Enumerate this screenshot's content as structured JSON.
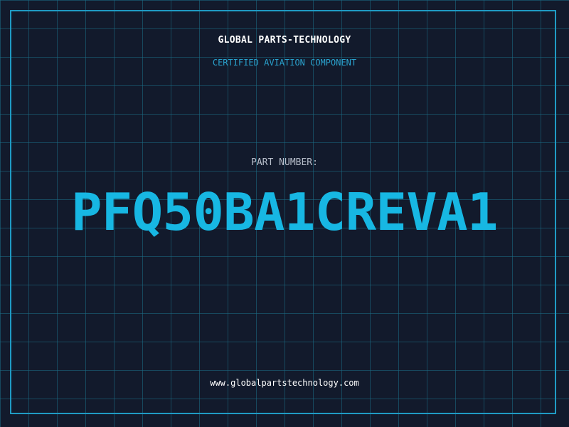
{
  "header": {
    "company": "GLOBAL PARTS-TECHNOLOGY",
    "tagline": "CERTIFIED AVIATION COMPONENT"
  },
  "part": {
    "label": "PART NUMBER:",
    "number": "PFQ50BA1CREVA1"
  },
  "footer": {
    "website": "www.globalpartstechnology.com"
  },
  "colors": {
    "background": "#121a2c",
    "grid": "#1b6e87",
    "accent": "#17b7e3",
    "frame": "#1f9bc4"
  }
}
